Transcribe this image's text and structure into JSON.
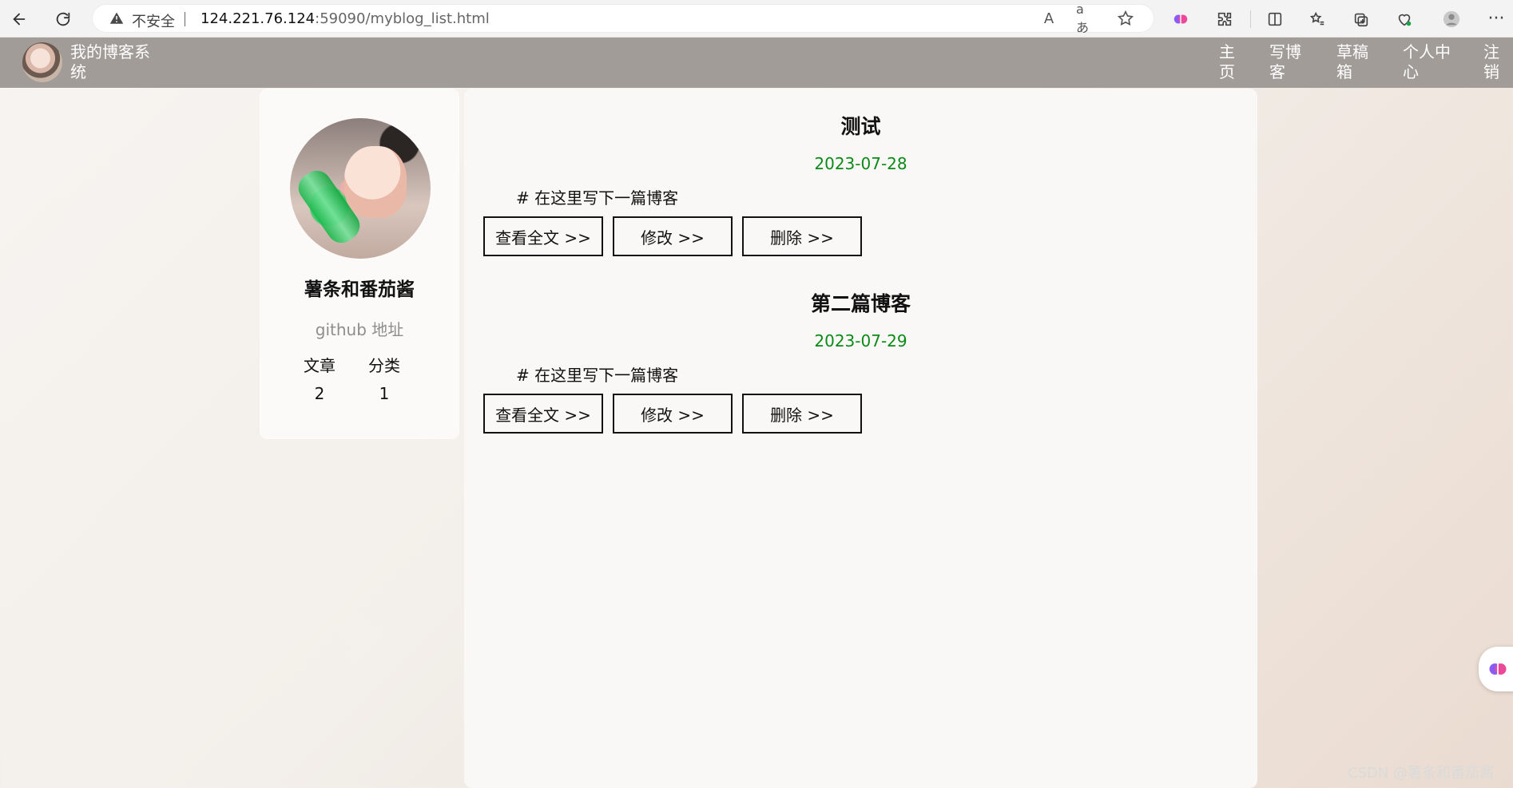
{
  "browser": {
    "security_label": "不安全",
    "url_host": "124.221.76.124",
    "url_rest": ":59090/myblog_list.html",
    "icons": {
      "back": "back-arrow-icon",
      "refresh": "refresh-icon",
      "warning": "warning-icon",
      "read_aloud": "read-aloud-icon",
      "translate": "translate-icon",
      "favorite": "star-icon",
      "copilot": "brain-icon",
      "extensions": "puzzle-icon",
      "split_screen": "split-screen-icon",
      "favorites": "favorites-icon",
      "collections": "collections-icon",
      "health": "health-icon",
      "profile": "profile-icon",
      "more": "more-icon"
    },
    "read_aloud_text": "A",
    "translate_text": "aあ",
    "more_text": "···"
  },
  "site_header": {
    "title": "我的博客系统",
    "nav": [
      {
        "label": "主页"
      },
      {
        "label": "写博客"
      },
      {
        "label": "草稿箱"
      },
      {
        "label": "个人中心"
      },
      {
        "label": "注销"
      }
    ]
  },
  "profile": {
    "name": "薯条和番茄酱",
    "github_label": "github 地址",
    "stats": {
      "articles_label": "文章",
      "categories_label": "分类",
      "articles_count": "2",
      "categories_count": "1"
    }
  },
  "posts": [
    {
      "title": "测试",
      "date": "2023-07-28",
      "summary": "# 在这里写下一篇博客",
      "actions": {
        "view": "查看全文 >>",
        "edit": "修改 >>",
        "delete": "删除 >>"
      }
    },
    {
      "title": "第二篇博客",
      "date": "2023-07-29",
      "summary": "# 在这里写下一篇博客",
      "actions": {
        "view": "查看全文 >>",
        "edit": "修改 >>",
        "delete": "删除 >>"
      }
    }
  ],
  "watermark": "CSDN @薯条和番茄酱",
  "colors": {
    "date_green": "#0b8a18",
    "header_bg": "#a19c97",
    "card_bg": "#faf8f6"
  }
}
